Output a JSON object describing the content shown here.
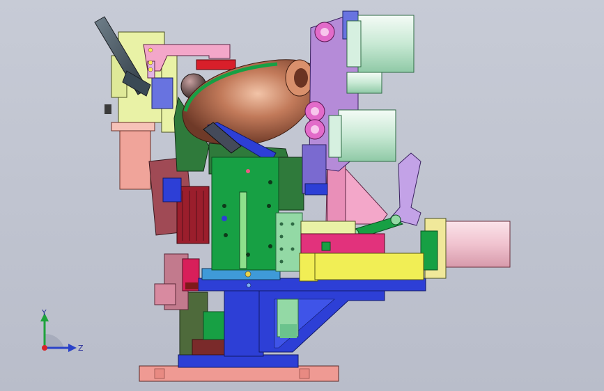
{
  "viewport": {
    "background": "#bcc0cd"
  },
  "triad": {
    "y_label": "Y",
    "z_label": "Z",
    "y_color": "#1fa33c",
    "z_color": "#2a42c8",
    "origin_color": "#d8232a"
  },
  "model": {
    "colors": {
      "base_plate": "#ef9a93",
      "blue": "#2d3fd6",
      "dark_green": "#2f7a3b",
      "green": "#17a044",
      "light_green": "#93d9a5",
      "yellow": "#f1ee55",
      "pink": "#f3a7c9",
      "magenta": "#e2327c",
      "purple": "#b58bd8",
      "lavender": "#c3a2e7",
      "copper": "#b06a50",
      "red": "#d81f2a",
      "gray": "#b9bdbe",
      "pale_yellow": "#e9f2a6",
      "salmon": "#f0a49a",
      "dark_red": "#7a2a2a"
    }
  }
}
